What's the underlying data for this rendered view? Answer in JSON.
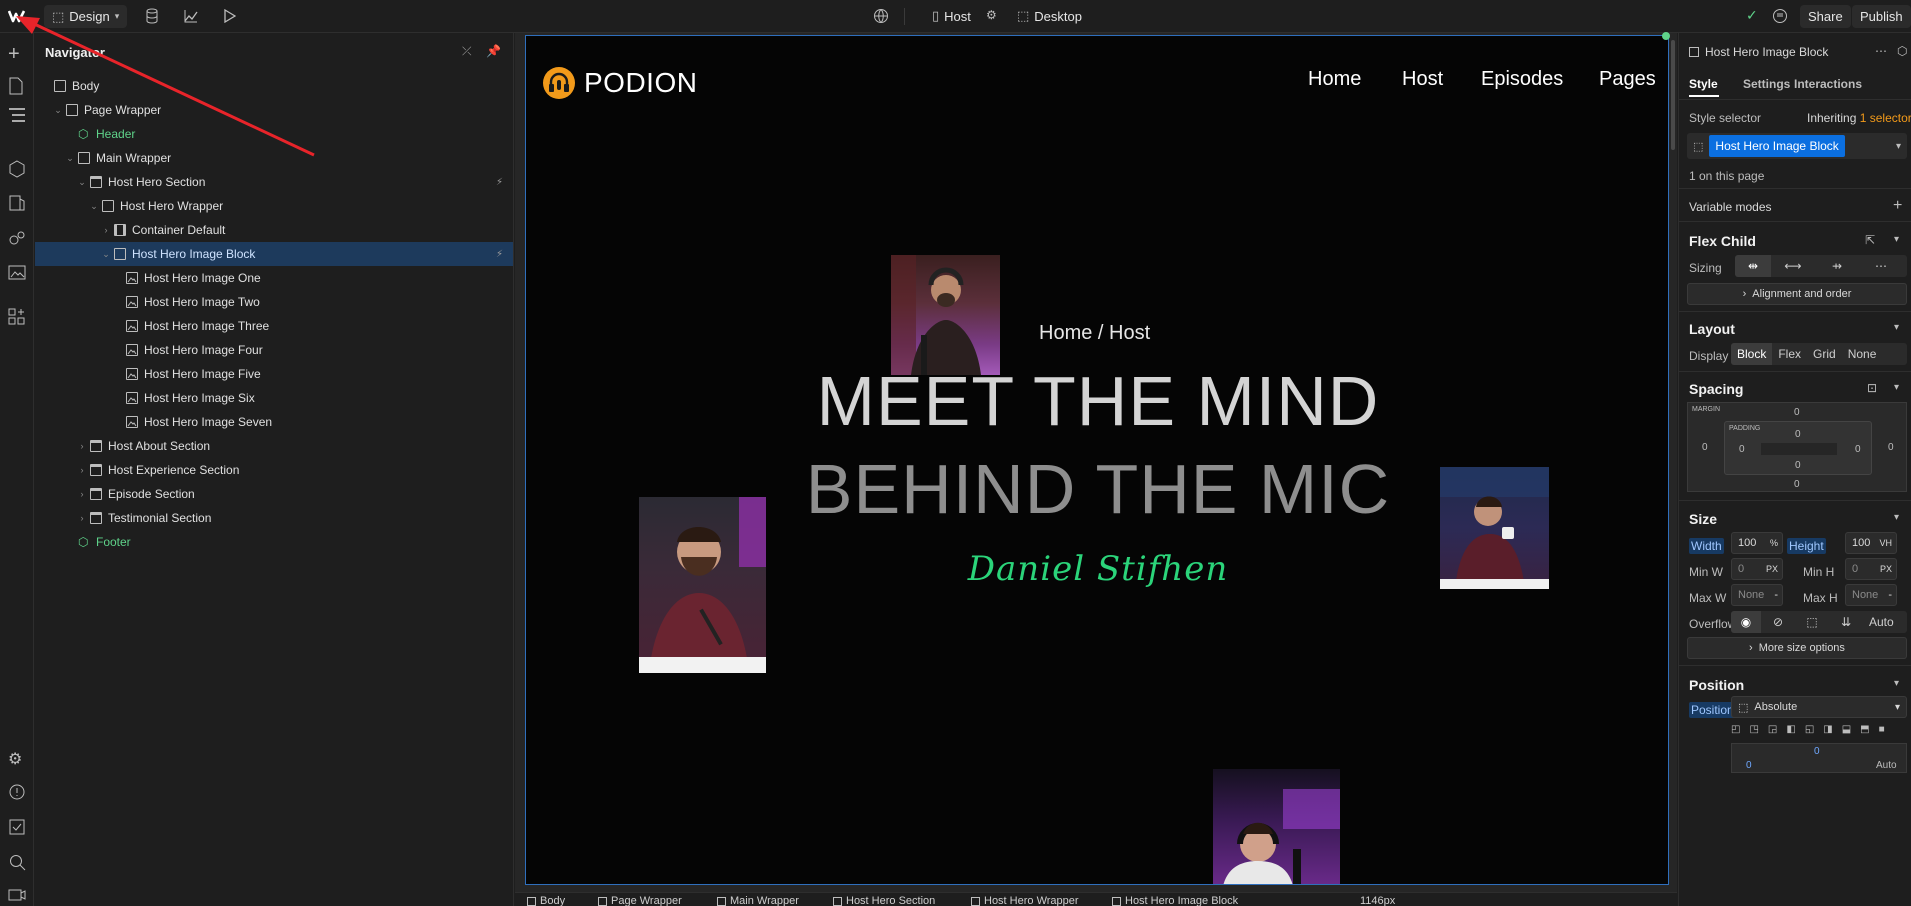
{
  "topbar": {
    "mode_label": "Design",
    "page_label": "Host",
    "breakpoint_label": "Desktop",
    "share_label": "Share",
    "publish_label": "Publish"
  },
  "navigator": {
    "title": "Navigator",
    "tree": [
      {
        "label": "Body",
        "depth": 0,
        "icon": "box",
        "arrow": ""
      },
      {
        "label": "Page Wrapper",
        "depth": 1,
        "icon": "box",
        "arrow": "v"
      },
      {
        "label": "Header",
        "depth": 2,
        "icon": "component",
        "arrow": ""
      },
      {
        "label": "Main Wrapper",
        "depth": 2,
        "icon": "box",
        "arrow": "v"
      },
      {
        "label": "Host Hero Section",
        "depth": 3,
        "icon": "section",
        "arrow": "v",
        "bolt": true
      },
      {
        "label": "Host Hero Wrapper",
        "depth": 4,
        "icon": "box",
        "arrow": "v"
      },
      {
        "label": "Container Default",
        "depth": 5,
        "icon": "container",
        "arrow": ">"
      },
      {
        "label": "Host Hero Image Block",
        "depth": 5,
        "icon": "box",
        "arrow": "v",
        "selected": true,
        "bolt": true
      },
      {
        "label": "Host Hero Image One",
        "depth": 6,
        "icon": "image",
        "arrow": ""
      },
      {
        "label": "Host Hero Image Two",
        "depth": 6,
        "icon": "image",
        "arrow": ""
      },
      {
        "label": "Host Hero Image Three",
        "depth": 6,
        "icon": "image",
        "arrow": ""
      },
      {
        "label": "Host Hero Image Four",
        "depth": 6,
        "icon": "image",
        "arrow": ""
      },
      {
        "label": "Host Hero Image Five",
        "depth": 6,
        "icon": "image",
        "arrow": ""
      },
      {
        "label": "Host Hero Image Six",
        "depth": 6,
        "icon": "image",
        "arrow": ""
      },
      {
        "label": "Host Hero Image Seven",
        "depth": 6,
        "icon": "image",
        "arrow": ""
      },
      {
        "label": "Host About Section",
        "depth": 3,
        "icon": "section",
        "arrow": ">"
      },
      {
        "label": "Host Experience Section",
        "depth": 3,
        "icon": "section",
        "arrow": ">"
      },
      {
        "label": "Episode Section",
        "depth": 3,
        "icon": "section",
        "arrow": ">"
      },
      {
        "label": "Testimonial Section",
        "depth": 3,
        "icon": "section",
        "arrow": ">"
      },
      {
        "label": "Footer",
        "depth": 2,
        "icon": "component",
        "arrow": ""
      }
    ]
  },
  "site": {
    "logo_text": "PODION",
    "nav": [
      "Home",
      "Host",
      "Episodes",
      "Pages"
    ],
    "breadcrumb": "Home / Host",
    "hero_line1": "MEET THE MIND",
    "hero_line2": "BEHIND THE MIC",
    "signature": "Daniel Stifhen"
  },
  "bottombar": {
    "crumbs": [
      "Body",
      "Page Wrapper",
      "Main Wrapper",
      "Host Hero Section",
      "Host Hero Wrapper",
      "Host Hero Image Block"
    ],
    "width_readout": "1146px"
  },
  "panel": {
    "element_name": "Host Hero Image Block",
    "tabs": [
      "Style",
      "Settings",
      "Interactions"
    ],
    "style_selector_label": "Style selector",
    "inheriting_label": "Inheriting",
    "inheriting_count": "1 selector",
    "selector_chip": "Host Hero Image Block",
    "on_page": "1 on this page",
    "variable_modes": "Variable modes",
    "flex_child": {
      "title": "Flex Child",
      "sizing_label": "Sizing",
      "alignment_label": "Alignment and order"
    },
    "layout": {
      "title": "Layout",
      "display_label": "Display",
      "options": [
        "Block",
        "Flex",
        "Grid",
        "None"
      ],
      "selected": "Block"
    },
    "spacing": {
      "title": "Spacing",
      "margin_label": "MARGIN",
      "padding_label": "PADDING",
      "margin": {
        "top": "0",
        "right": "0",
        "bottom": "0",
        "left": "0"
      },
      "padding": {
        "top": "0",
        "right": "0",
        "bottom": "0",
        "left": "0"
      }
    },
    "size": {
      "title": "Size",
      "width_label": "Width",
      "width_value": "100",
      "width_unit": "%",
      "height_label": "Height",
      "height_value": "100",
      "height_unit": "VH",
      "minw_label": "Min W",
      "minw_value": "0",
      "minw_unit": "PX",
      "minh_label": "Min H",
      "minh_value": "0",
      "minh_unit": "PX",
      "maxw_label": "Max W",
      "maxw_value": "None",
      "maxw_unit": "-",
      "maxh_label": "Max H",
      "maxh_value": "None",
      "maxh_unit": "-",
      "overflow_label": "Overflow",
      "overflow_auto": "Auto",
      "more_label": "More size options"
    },
    "position": {
      "title": "Position",
      "label": "Position",
      "value": "Absolute",
      "offset_top": "0",
      "offset_right": "Auto"
    }
  },
  "colors": {
    "accent_blue": "#0b6fe0",
    "selection_bg": "#1d3a5c",
    "component_green": "#5fd38a",
    "signature_green": "#2bd47a",
    "canvas_border": "#2f6fbd",
    "annotation_red": "#e8242a"
  }
}
